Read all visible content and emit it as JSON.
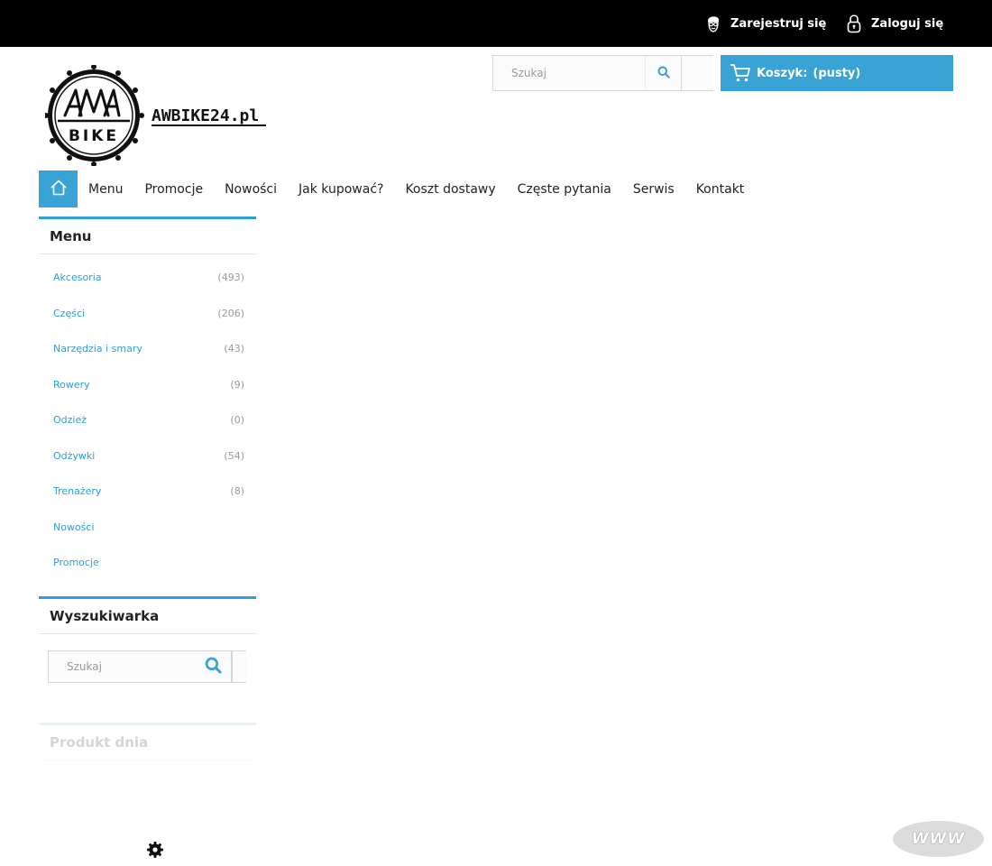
{
  "topbar": {
    "register_label": "Zarejestruj się",
    "login_label": "Zaloguj się"
  },
  "logo": {
    "badge_text_top": "AW",
    "badge_text_bottom": "BIKE",
    "site_name": "AWBIKE24.pl"
  },
  "header_search": {
    "placeholder": "Szukaj",
    "icon": "search-icon"
  },
  "cart": {
    "label": "Koszyk:",
    "status": "(pusty)",
    "icon": "cart-icon"
  },
  "nav": {
    "home_icon": "home-icon",
    "items": [
      {
        "label": "Menu"
      },
      {
        "label": "Promocje"
      },
      {
        "label": "Nowości"
      },
      {
        "label": "Jak kupować?"
      },
      {
        "label": "Koszt dostawy"
      },
      {
        "label": "Częste pytania"
      },
      {
        "label": "Serwis"
      },
      {
        "label": "Kontakt"
      }
    ]
  },
  "sidebar": {
    "menu_title": "Menu",
    "categories": [
      {
        "name": "Akcesoria",
        "count": "(493)"
      },
      {
        "name": "Części",
        "count": "(206)"
      },
      {
        "name": "Narzędzia i smary",
        "count": "(43)"
      },
      {
        "name": "Rowery",
        "count": "(9)"
      },
      {
        "name": "Odzież",
        "count": "(0)"
      },
      {
        "name": "Odżywki",
        "count": "(54)"
      },
      {
        "name": "Trenażery",
        "count": "(8)"
      },
      {
        "name": "Nowości",
        "count": ""
      },
      {
        "name": "Promocje",
        "count": ""
      }
    ],
    "search_title": "Wyszukiwarka",
    "search_placeholder": "Szukaj",
    "product_title": "Produkt dnia"
  },
  "floating": {
    "www_badge": "WWW",
    "settings_icon": "gear-icon"
  },
  "colors": {
    "accent": "#39a3d5",
    "link": "#2d9fd9",
    "topbar": "#000000"
  }
}
